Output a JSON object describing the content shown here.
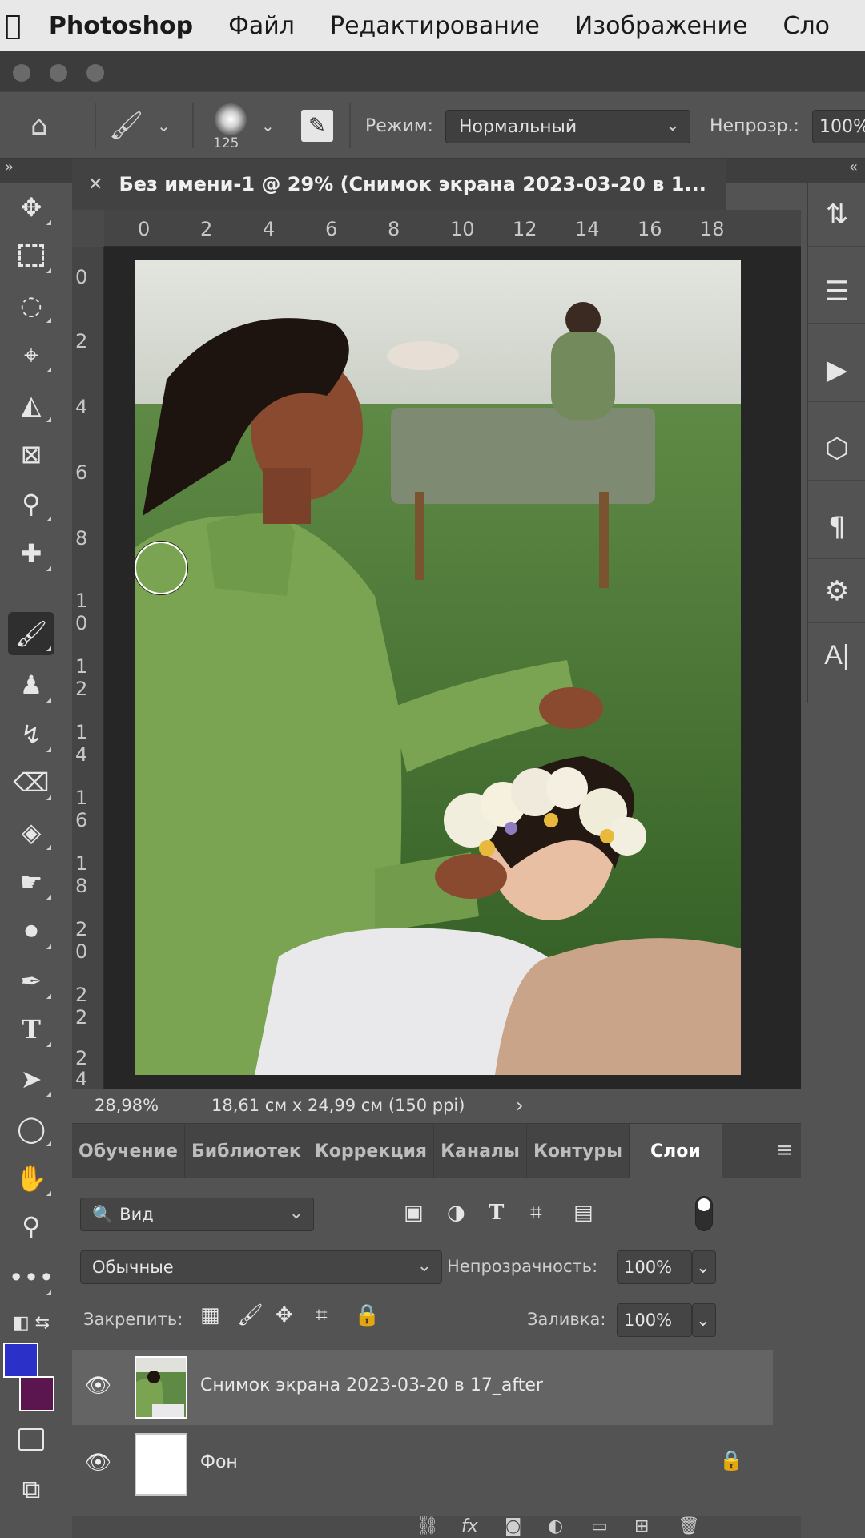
{
  "menubar": {
    "app_name": "Photoshop",
    "items": [
      "Файл",
      "Редактирование",
      "Изображение",
      "Сло"
    ]
  },
  "options_bar": {
    "brush_size": "125",
    "mode_label": "Режим:",
    "mode_value": "Нормальный",
    "opacity_label": "Непрозр.:",
    "opacity_value": "100%"
  },
  "document": {
    "tab_title": "Без имени-1 @ 29% (Снимок экрана 2023-03-20 в 1...",
    "ruler_top": [
      "0",
      "2",
      "4",
      "6",
      "8",
      "10",
      "12",
      "14",
      "16",
      "18"
    ],
    "ruler_left": [
      "0",
      "2",
      "4",
      "6",
      "8",
      "1\n0",
      "1\n2",
      "1\n4",
      "1\n6",
      "1\n8",
      "2\n0",
      "2\n2",
      "2\n4"
    ],
    "zoom": "28,98%",
    "dimensions": "18,61 см x 24,99 см (150 ppi)",
    "status_arrow": "›"
  },
  "panel": {
    "tabs": [
      "Обучение",
      "Библиотек",
      "Коррекция",
      "Каналы",
      "Контуры",
      "Слои"
    ],
    "active_tab": "Слои",
    "filter_label": "Вид",
    "blend_mode": "Обычные",
    "opacity_label": "Непрозрачность:",
    "opacity_value": "100%",
    "lock_label": "Закрепить:",
    "fill_label": "Заливка:",
    "fill_value": "100%",
    "layers": [
      {
        "name": "Снимок экрана 2023-03-20 в 17_after",
        "selected": true
      },
      {
        "name": "Фон",
        "selected": false,
        "locked": true
      }
    ]
  },
  "colors": {
    "foreground": "#2b31c8",
    "background": "#5b1650"
  }
}
